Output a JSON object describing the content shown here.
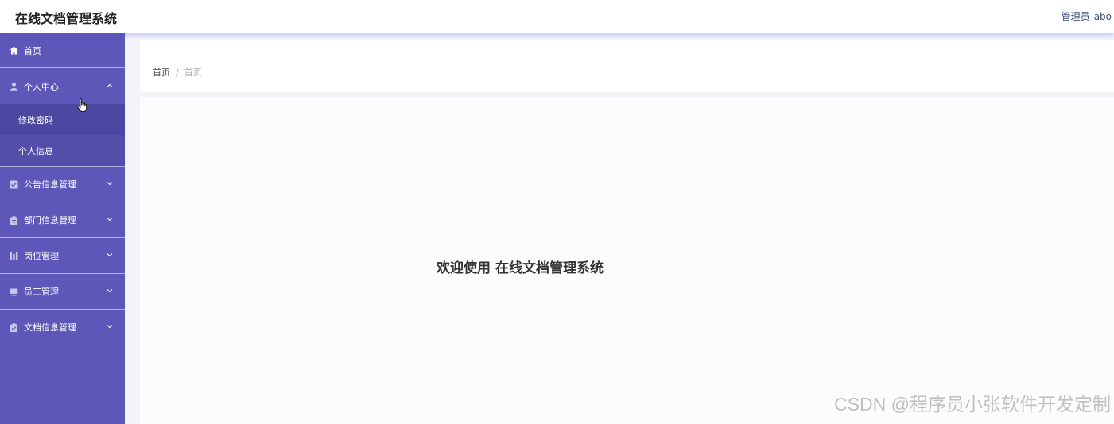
{
  "header": {
    "title": "在线文档管理系统",
    "role": "管理员",
    "username": "abo"
  },
  "sidebar": {
    "items": [
      {
        "label": "首页",
        "icon": "home-icon"
      },
      {
        "label": "个人中心",
        "icon": "user-icon",
        "expanded": true,
        "children": [
          {
            "label": "修改密码"
          },
          {
            "label": "个人信息"
          }
        ]
      },
      {
        "label": "公告信息管理",
        "icon": "checkbox-icon"
      },
      {
        "label": "部门信息管理",
        "icon": "clipboard-icon"
      },
      {
        "label": "岗位管理",
        "icon": "chart-icon"
      },
      {
        "label": "员工管理",
        "icon": "monitor-icon"
      },
      {
        "label": "文档信息管理",
        "icon": "document-check-icon"
      }
    ]
  },
  "breadcrumb": {
    "root": "首页",
    "separator": "/",
    "current": "首页"
  },
  "main": {
    "welcome": "欢迎使用 在线文档管理系统"
  },
  "watermark": "CSDN @程序员小张软件开发定制",
  "colors": {
    "sidebar_bg": "#5c57b8",
    "accent": "#5c57b8"
  }
}
